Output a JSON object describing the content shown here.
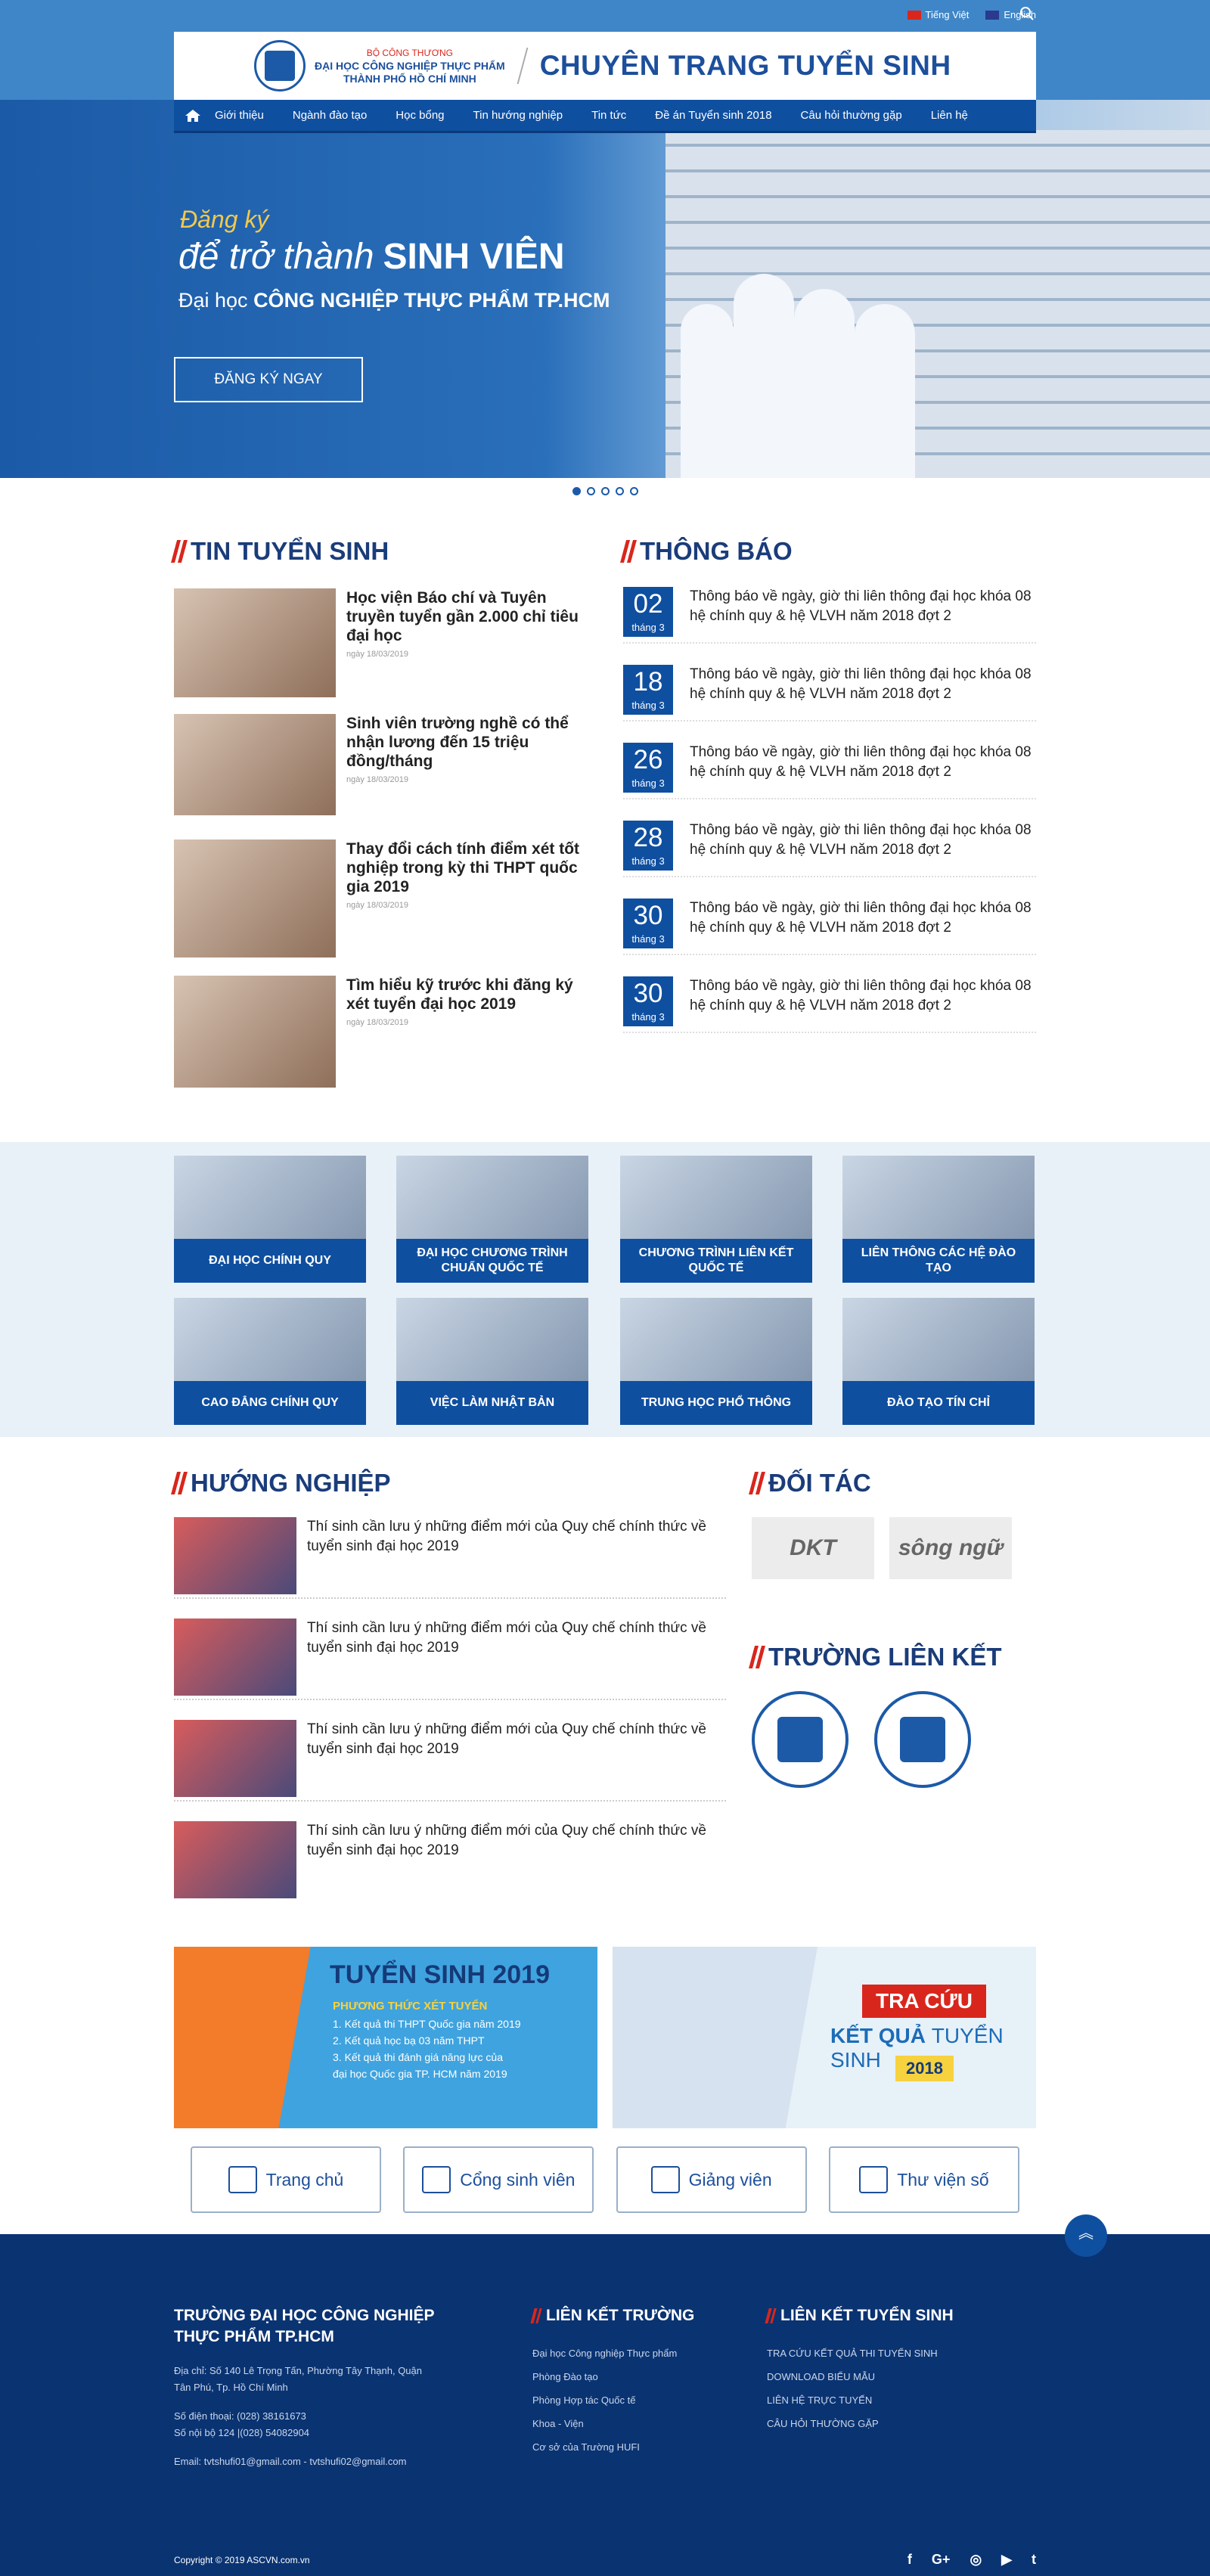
{
  "topbar": {
    "lang_vi": "Tiếng Việt",
    "lang_en": "English",
    "search_icon": "search-icon"
  },
  "header": {
    "ministry": "BỘ CÔNG THƯƠNG",
    "school_line1": "ĐẠI HỌC CÔNG NGHIỆP THỰC PHẨM",
    "school_line2": "THÀNH PHỐ HỒ CHÍ MINH",
    "brand": "CHUYÊN TRANG TUYỂN SINH"
  },
  "nav": {
    "items": [
      "Giới thiệu",
      "Ngành đào tạo",
      "Học bổng",
      "Tin hướng nghiệp",
      "Tin tức",
      "Đề án Tuyển sinh 2018",
      "Câu hỏi thường gặp",
      "Liên hệ"
    ]
  },
  "hero": {
    "line1": "Đăng ký",
    "line2a": "để trở thành",
    "line2b": "SINH VIÊN",
    "line3a": "Đại học",
    "line3b": "CÔNG NGHIỆP THỰC PHẨM TP.HCM",
    "button": "ĐĂNG KÝ NGAY"
  },
  "news": {
    "title": "TIN TUYỂN SINH",
    "items": [
      {
        "title": "Học viện Báo chí và Tuyên truyền tuyển gần 2.000 chỉ tiêu đại học",
        "date": "ngày 18/03/2019"
      },
      {
        "title": "Sinh viên trường nghề có thể nhận lương đến 15 triệu đồng/tháng",
        "date": "ngày 18/03/2019"
      },
      {
        "title": "Thay đổi cách tính điểm xét tốt nghiệp trong kỳ thi THPT quốc gia 2019",
        "date": "ngày 18/03/2019"
      },
      {
        "title": "Tìm hiểu kỹ trước khi đăng ký xét tuyển đại học 2019",
        "date": "ngày 18/03/2019"
      }
    ]
  },
  "notices": {
    "title": "THÔNG BÁO",
    "items": [
      {
        "day": "02",
        "month": "tháng 3",
        "text": "Thông báo về ngày, giờ thi liên thông đại học khóa 08 hệ chính quy & hệ VLVH năm 2018 đợt 2"
      },
      {
        "day": "18",
        "month": "tháng 3",
        "text": "Thông báo về ngày, giờ thi liên thông đại học khóa 08 hệ chính quy & hệ VLVH năm 2018 đợt 2"
      },
      {
        "day": "26",
        "month": "tháng 3",
        "text": "Thông báo về ngày, giờ thi liên thông đại học khóa 08 hệ chính quy & hệ VLVH năm 2018 đợt 2"
      },
      {
        "day": "28",
        "month": "tháng 3",
        "text": "Thông báo về ngày, giờ thi liên thông đại học khóa 08 hệ chính quy & hệ VLVH năm 2018 đợt 2"
      },
      {
        "day": "30",
        "month": "tháng 3",
        "text": "Thông báo về ngày, giờ thi liên thông đại học khóa 08 hệ chính quy & hệ VLVH năm 2018 đợt 2"
      },
      {
        "day": "30",
        "month": "tháng 3",
        "text": "Thông báo về ngày, giờ thi liên thông đại học khóa 08 hệ chính quy & hệ VLVH năm 2018 đợt 2"
      }
    ]
  },
  "categories": [
    "ĐẠI HỌC CHÍNH QUY",
    "ĐẠI HỌC CHƯƠNG TRÌNH CHUẨN QUỐC TẾ",
    "CHƯƠNG TRÌNH LIÊN KẾT QUỐC TẾ",
    "LIÊN THÔNG CÁC HỆ ĐÀO TẠO",
    "CAO ĐẲNG CHÍNH QUY",
    "VIỆC LÀM NHẬT BẢN",
    "TRUNG HỌC PHỔ THÔNG",
    "ĐÀO TẠO TÍN CHỈ"
  ],
  "career": {
    "title": "HƯỚNG NGHIỆP",
    "items": [
      "Thí sinh cần lưu ý những điểm mới của Quy chế chính thức về tuyển sinh đại học 2019",
      "Thí sinh cần lưu ý những điểm mới của Quy chế chính thức về tuyển sinh đại học 2019",
      "Thí sinh cần lưu ý những điểm mới của Quy chế chính thức về tuyển sinh đại học 2019",
      "Thí sinh cần lưu ý những điểm mới của Quy chế chính thức về tuyển sinh đại học 2019"
    ]
  },
  "partners": {
    "title": "ĐỐI TÁC",
    "items": [
      "DKT",
      "sông ngữ"
    ]
  },
  "schools": {
    "title": "TRƯỜNG LIÊN KẾT"
  },
  "banner1": {
    "title": "TUYỂN SINH 2019",
    "subtitle": "PHƯƠNG THỨC XÉT TUYỂN",
    "lines": [
      "1. Kết quả thi THPT Quốc gia năm 2019",
      "2. Kết quả học bạ 03 năm THPT",
      "3. Kết quả thi đánh giá năng lực của",
      "đại học Quốc gia TP. HCM năm 2019"
    ]
  },
  "banner2": {
    "red": "TRA CỨU",
    "kq_bold": "KẾT QUẢ",
    "kq_rest": "TUYỂN SINH",
    "year": "2018"
  },
  "quick": [
    "Trang chủ",
    "Cổng sinh viên",
    "Giảng viên",
    "Thư viện số"
  ],
  "footer": {
    "school": "TRƯỜNG ĐẠI HỌC CÔNG NGHIỆP THỰC PHẨM TP.HCM",
    "address": "Địa chỉ: Số 140 Lê Trọng Tấn, Phường Tây Thạnh, Quận Tân Phú, Tp. Hồ Chí Minh",
    "phone": "Số điện thoại: (028) 38161673",
    "ext": "Số nội bộ 124 |(028) 54082904",
    "email": "Email: tvtshufi01@gmail.com - tvtshufi02@gmail.com",
    "col2_title": "LIÊN KẾT TRƯỜNG",
    "col2_links": [
      "Đại học Công nghiệp Thực phẩm",
      "Phòng Đào tạo",
      "Phòng Hợp tác Quốc tế",
      "Khoa - Viện",
      "Cơ sở của Trường HUFI"
    ],
    "col3_title": "LIÊN KẾT TUYỂN SINH",
    "col3_links": [
      "TRA CỨU KẾT QUẢ THI TUYỂN SINH",
      "DOWNLOAD BIỂU MẪU",
      "LIÊN HỆ TRỰC TUYẾN",
      "CÂU HỎI THƯỜNG GẶP"
    ],
    "copyright": "Copyright © 2019 ASCVN.com.vn",
    "social": [
      "f",
      "G+",
      "◎",
      "▶",
      "t"
    ]
  }
}
